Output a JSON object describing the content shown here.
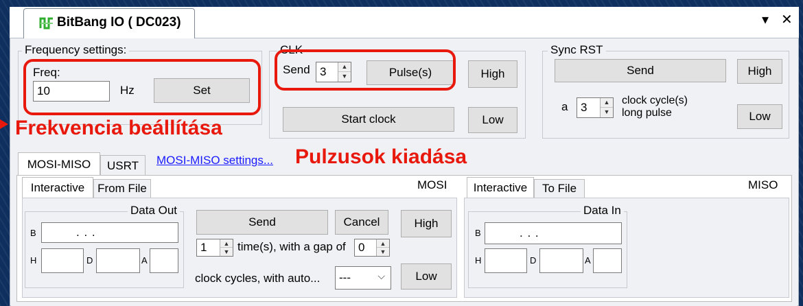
{
  "window": {
    "tab_title": "BitBang IO ( DC023)",
    "dropdown_glyph": "▾",
    "close_glyph": "✕"
  },
  "frequency": {
    "group_title": "Frequency settings:",
    "freq_label": "Freq:",
    "freq_value": "10",
    "unit": "Hz",
    "set_button": "Set"
  },
  "clk": {
    "group_title": "CLK",
    "send_label": "Send",
    "pulse_count": "3",
    "pulse_button": "Pulse(s)",
    "high_button": "High",
    "start_clock_button": "Start clock",
    "low_button": "Low"
  },
  "sync_rst": {
    "group_title": "Sync RST",
    "send_button": "Send",
    "high_button": "High",
    "a_label": "a",
    "cycles_value": "3",
    "cycles_label_1": "clock cycle(s)",
    "cycles_label_2": "long pulse",
    "low_button": "Low"
  },
  "annotations": {
    "frequency": "Frekvencia beállítása",
    "pulses": "Pulzusok kiadása"
  },
  "mode_tabs": [
    "MOSI-MISO",
    "USRT"
  ],
  "mosi_miso_settings_link": "MOSI-MISO settings...",
  "mosi": {
    "tabs": [
      "Interactive",
      "From File"
    ],
    "title": "MOSI",
    "group_title": "Data Out",
    "b_label": "B",
    "b_dots": ".          .          .",
    "h_label": "H",
    "d_label": "D",
    "a_label": "A",
    "send_button": "Send",
    "cancel_button": "Cancel",
    "high_button": "High",
    "repeat_value": "1",
    "repeat_label": "time(s), with a gap of",
    "gap_value": "0",
    "auto_label": "clock cycles, with auto...",
    "auto_value": "---",
    "low_button": "Low"
  },
  "miso": {
    "tabs": [
      "Interactive",
      "To File"
    ],
    "title": "MISO",
    "group_title": "Data In",
    "b_label": "B",
    "b_dots": ".          .          .",
    "h_label": "H",
    "d_label": "D",
    "a_label": "A"
  },
  "colors": {
    "annotation_red": "#e8190c",
    "link_blue": "#1a1aff",
    "background_blue": "#0f2f5e"
  }
}
